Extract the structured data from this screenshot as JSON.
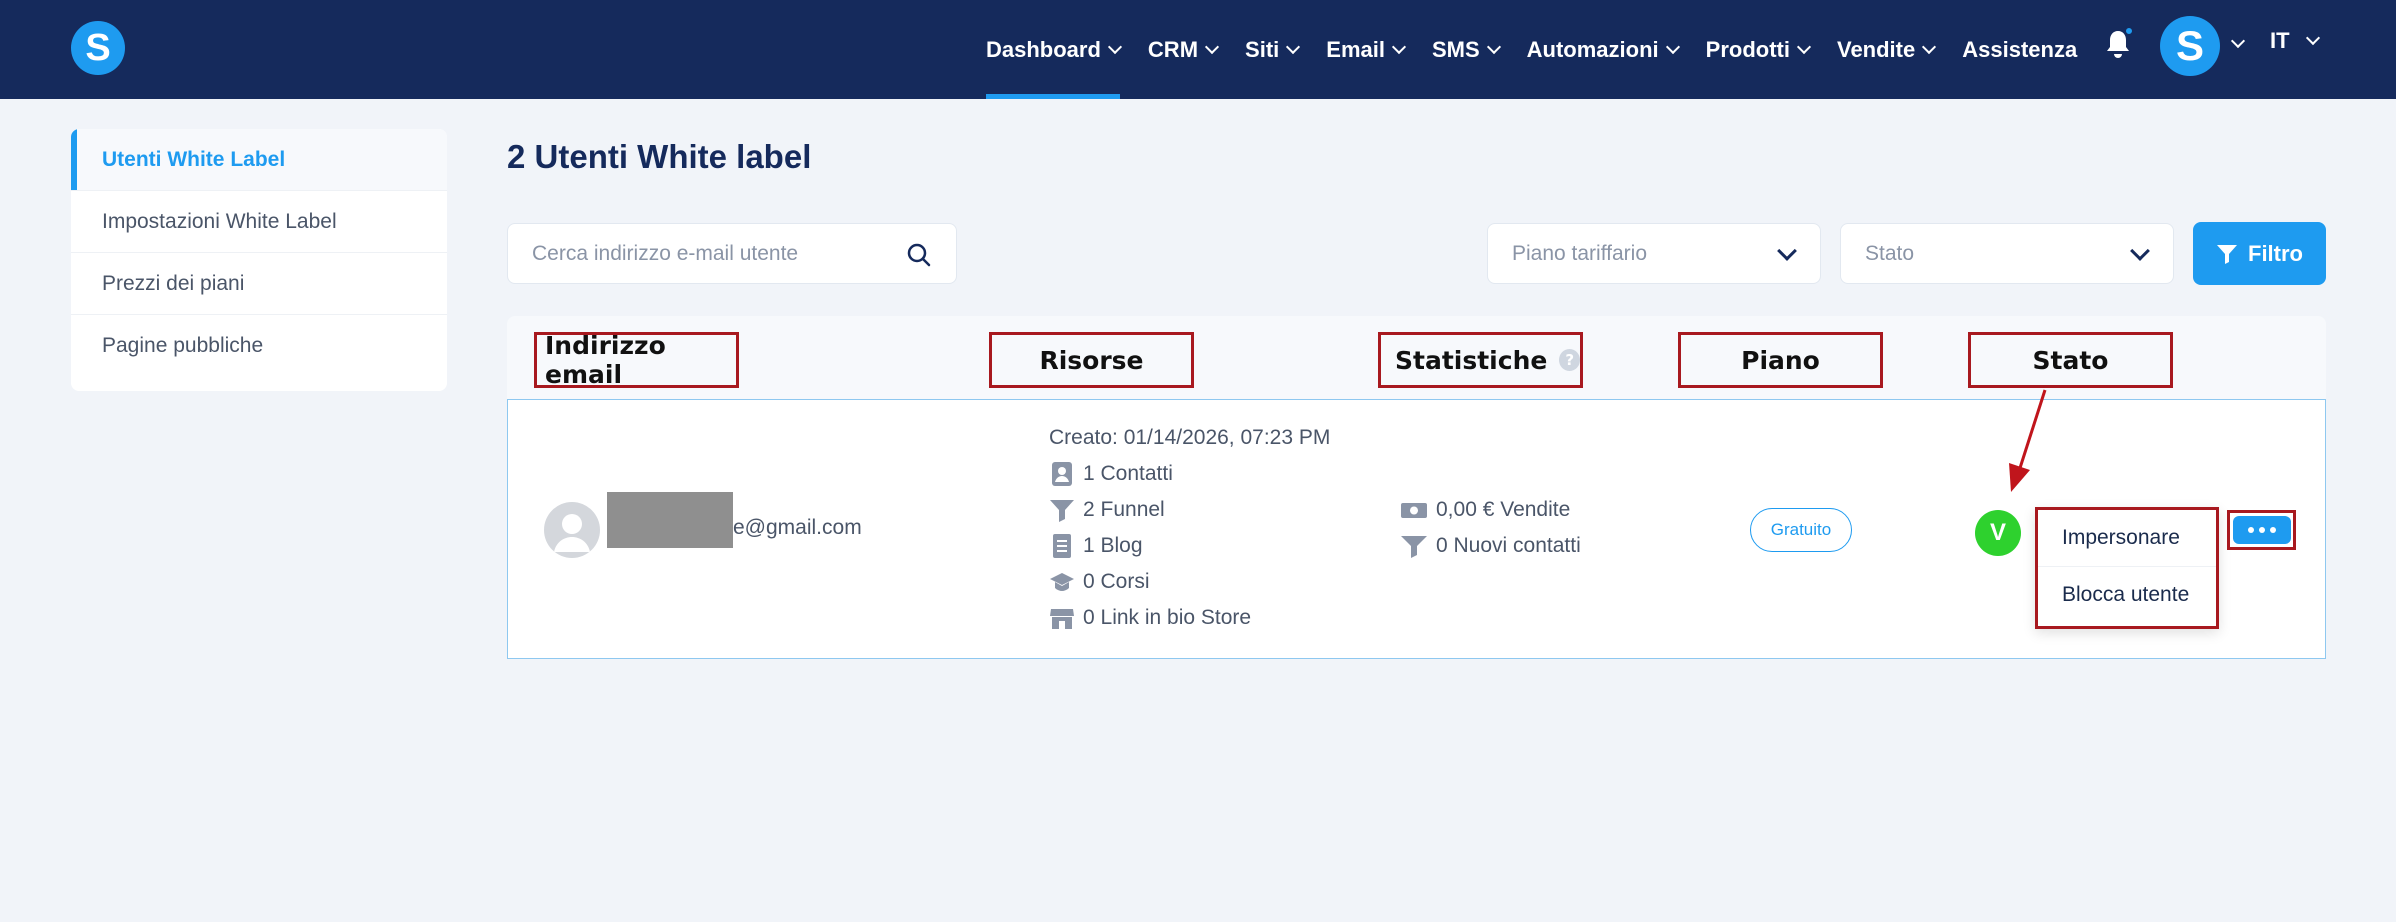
{
  "brand": {
    "logo_letter": "S"
  },
  "nav": {
    "items": [
      {
        "label": "Dashboard",
        "dropdown": true
      },
      {
        "label": "CRM",
        "dropdown": true
      },
      {
        "label": "Siti",
        "dropdown": true
      },
      {
        "label": "Email",
        "dropdown": true
      },
      {
        "label": "SMS",
        "dropdown": true
      },
      {
        "label": "Automazioni",
        "dropdown": true
      },
      {
        "label": "Prodotti",
        "dropdown": true
      },
      {
        "label": "Vendite",
        "dropdown": true
      },
      {
        "label": "Assistenza",
        "dropdown": false
      }
    ],
    "avatar_letter": "S",
    "language": "IT"
  },
  "sidebar": {
    "items": [
      {
        "label": "Utenti White Label"
      },
      {
        "label": "Impostazioni White Label"
      },
      {
        "label": "Prezzi dei piani"
      },
      {
        "label": "Pagine pubbliche"
      }
    ]
  },
  "main": {
    "title": "2 Utenti White label",
    "search_placeholder": "Cerca indirizzo e-mail utente",
    "plan_select": "Piano tariffario",
    "status_select": "Stato",
    "filter_label": "Filtro"
  },
  "table": {
    "headers": [
      "Indirizzo email",
      "Risorse",
      "Statistiche",
      "Piano",
      "Stato"
    ],
    "info_glyph": "?",
    "row": {
      "email_suffix": "e@gmail.com",
      "created": "Creato: 01/14/2026, 07:23 PM",
      "resources": [
        "1 Contatti",
        "2 Funnel",
        "1 Blog",
        "0 Corsi",
        "0 Link in bio Store"
      ],
      "stats": [
        "0,00 € Vendite",
        "0 Nuovi contatti"
      ],
      "plan": "Gratuito",
      "status_letter": "V"
    },
    "actions_menu": [
      "Impersonare",
      "Blocca utente"
    ]
  },
  "colors": {
    "nav_bg": "#152a5c",
    "accent": "#1e9bf0",
    "highlight": "#a8191f",
    "status_active": "#2ed12e"
  }
}
